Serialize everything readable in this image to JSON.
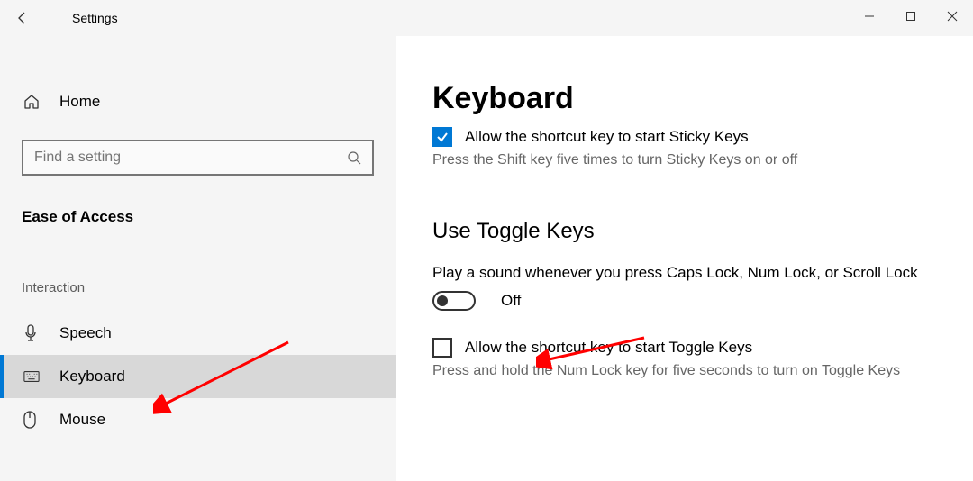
{
  "window": {
    "title": "Settings"
  },
  "sidebar": {
    "home_label": "Home",
    "search_placeholder": "Find a setting",
    "section_heading": "Ease of Access",
    "group_heading": "Interaction",
    "items": [
      {
        "label": "Speech"
      },
      {
        "label": "Keyboard"
      },
      {
        "label": "Mouse"
      }
    ]
  },
  "main": {
    "title": "Keyboard",
    "sticky_checkbox_label": "Allow the shortcut key to start Sticky Keys",
    "sticky_helper": "Press the Shift key five times to turn Sticky Keys on or off",
    "toggle_section_title": "Use Toggle Keys",
    "toggle_desc": "Play a sound whenever you press Caps Lock, Num Lock, or Scroll Lock",
    "toggle_state_label": "Off",
    "toggle_checkbox_label": "Allow the shortcut key to start Toggle Keys",
    "toggle_helper": "Press and hold the Num Lock key for five seconds to turn on Toggle Keys"
  }
}
